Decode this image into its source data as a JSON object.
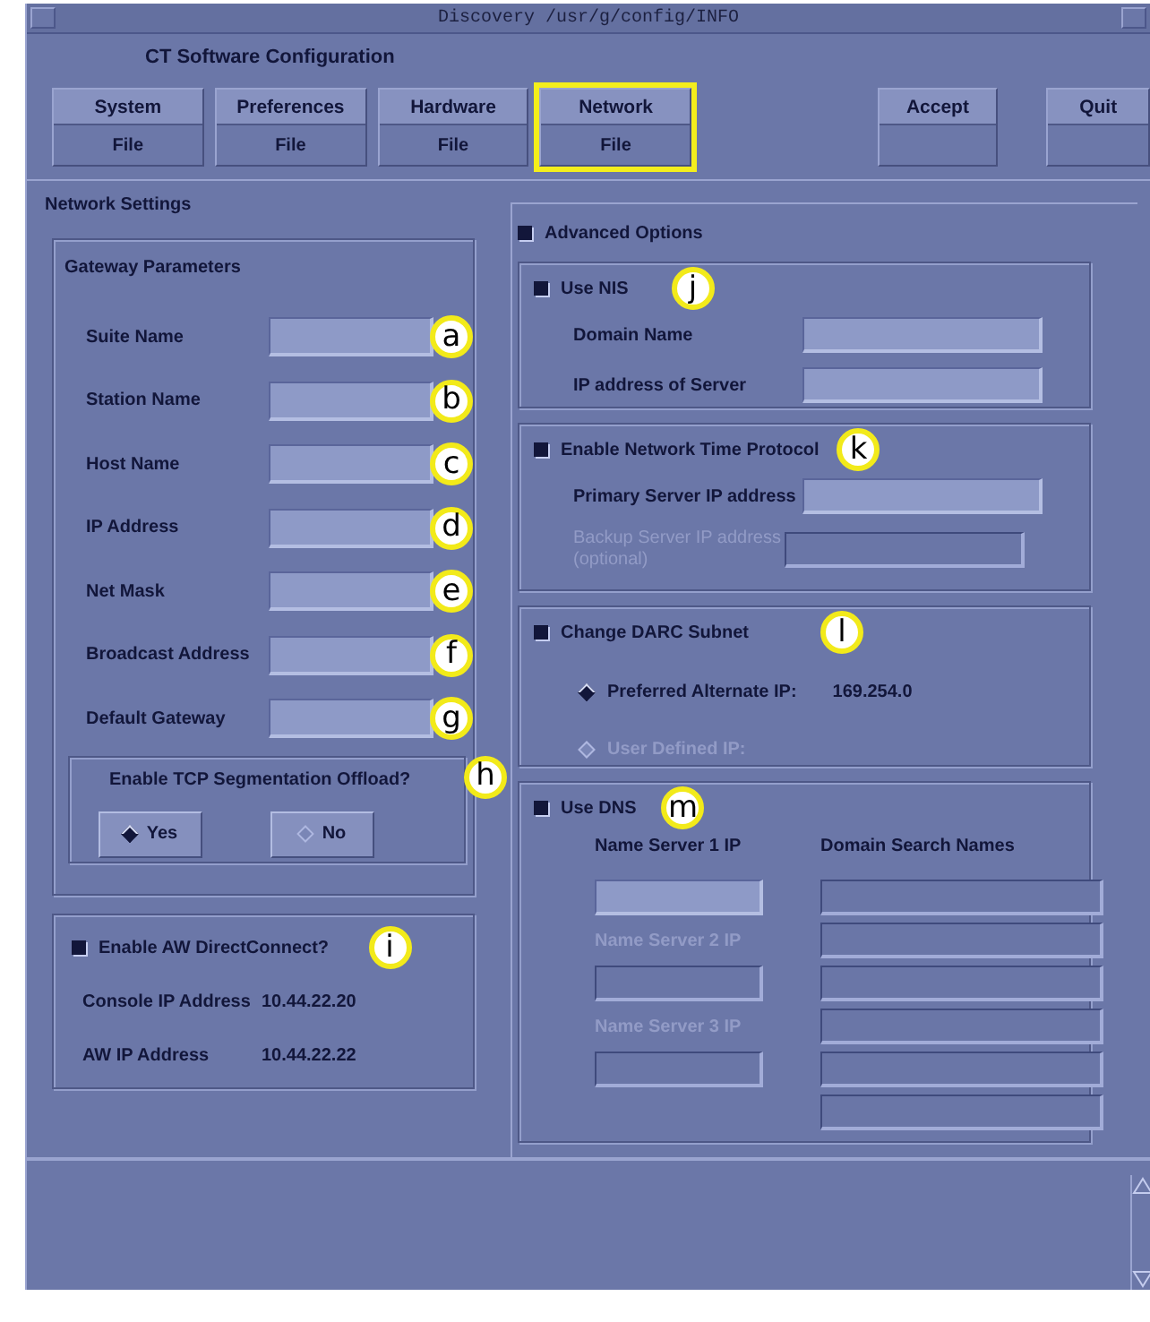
{
  "window": {
    "title": "Discovery /usr/g/config/INFO"
  },
  "app_title": "CT Software Configuration",
  "toolbar": [
    {
      "label": "System",
      "sublabel": "File",
      "selected": false
    },
    {
      "label": "Preferences",
      "sublabel": "File",
      "selected": false
    },
    {
      "label": "Hardware",
      "sublabel": "File",
      "selected": false
    },
    {
      "label": "Network",
      "sublabel": "File",
      "selected": true
    },
    {
      "label": "Accept",
      "kind": "action",
      "selected": false
    },
    {
      "label": "Quit",
      "kind": "action",
      "selected": false
    }
  ],
  "network_settings": {
    "title": "Network Settings",
    "gateway": {
      "title": "Gateway Parameters",
      "fields": [
        {
          "label": "Suite Name",
          "callout": "a"
        },
        {
          "label": "Station Name",
          "callout": "b"
        },
        {
          "label": "Host Name",
          "callout": "c"
        },
        {
          "label": "IP Address",
          "callout": "d"
        },
        {
          "label": "Net Mask",
          "callout": "e"
        },
        {
          "label": "Broadcast Address",
          "callout": "f"
        },
        {
          "label": "Default Gateway",
          "callout": "g"
        }
      ],
      "tso": {
        "question": "Enable TCP Segmentation Offload?",
        "callout": "h",
        "options": [
          {
            "label": "Yes",
            "selected": true
          },
          {
            "label": "No",
            "selected": false
          }
        ]
      }
    },
    "aw": {
      "label": "Enable AW DirectConnect?",
      "checked": true,
      "callout": "i",
      "rows": [
        {
          "label": "Console IP Address",
          "value": "10.44.22.20"
        },
        {
          "label": "AW IP Address",
          "value": "10.44.22.22"
        }
      ]
    }
  },
  "advanced": {
    "label": "Advanced Options",
    "checked": true,
    "nis": {
      "label": "Use NIS",
      "checked": true,
      "callout": "j",
      "fields": [
        {
          "label": "Domain Name",
          "disabled": false
        },
        {
          "label": "IP address of Server",
          "disabled": false
        }
      ]
    },
    "ntp": {
      "label": "Enable Network Time Protocol",
      "checked": true,
      "callout": "k",
      "fields": [
        {
          "label": "Primary Server IP address",
          "disabled": false
        },
        {
          "label": "Backup Server IP address (optional)",
          "disabled": true
        }
      ]
    },
    "darc": {
      "label": "Change DARC Subnet",
      "checked": true,
      "callout": "l",
      "options": [
        {
          "label": "Preferred Alternate IP:",
          "value": "169.254.0",
          "selected": true,
          "disabled": false
        },
        {
          "label": "User Defined IP:",
          "selected": false,
          "disabled": true
        }
      ]
    },
    "dns": {
      "label": "Use DNS",
      "checked": true,
      "callout": "m",
      "search_heading": "Domain Search Names",
      "name_servers": [
        {
          "label": "Name Server 1 IP",
          "disabled": false
        },
        {
          "label": "Name Server 2 IP",
          "disabled": true
        },
        {
          "label": "Name Server 3 IP",
          "disabled": true
        }
      ],
      "search_names": [
        {
          "disabled": true
        },
        {
          "disabled": true
        },
        {
          "disabled": true
        },
        {
          "disabled": true
        },
        {
          "disabled": true
        },
        {
          "disabled": true
        }
      ]
    }
  }
}
